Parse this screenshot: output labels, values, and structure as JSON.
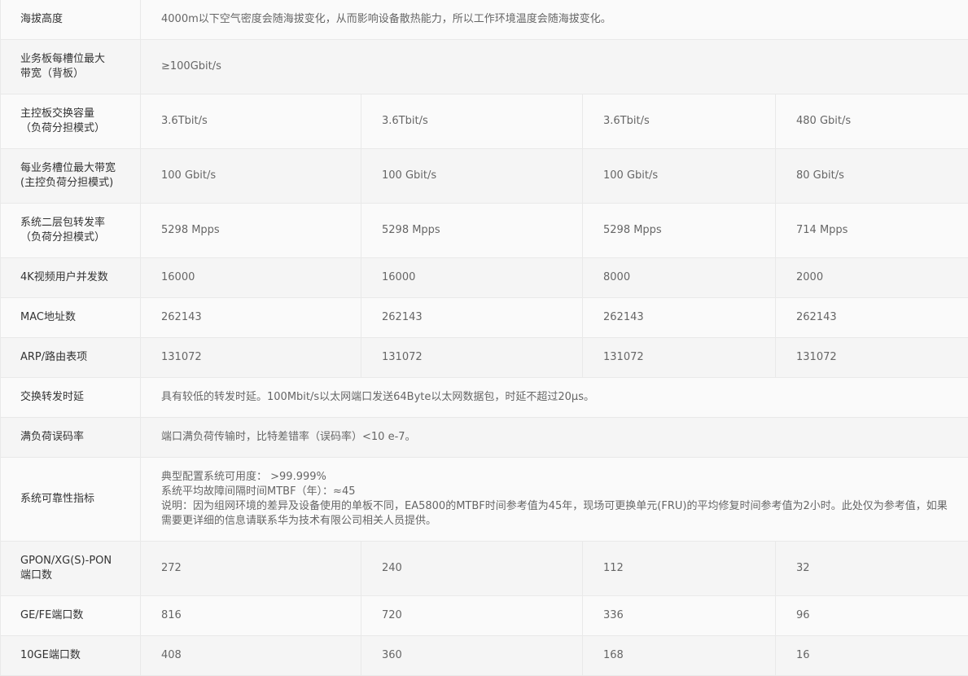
{
  "rows": [
    {
      "label": "海拔高度",
      "span": "4000m以下空气密度会随海拔变化，从而影响设备散热能力，所以工作环境温度会随海拔变化。"
    },
    {
      "label": "业务板每槽位最大带宽（背板）",
      "span": "≥100Gbit/s"
    },
    {
      "label": "主控板交换容量\n（负荷分担模式）",
      "cells": [
        "3.6Tbit/s",
        "3.6Tbit/s",
        "3.6Tbit/s",
        "480 Gbit/s"
      ]
    },
    {
      "label": "每业务槽位最大带宽\n(主控负荷分担模式)",
      "cells": [
        "100 Gbit/s",
        "100 Gbit/s",
        "100 Gbit/s",
        "80 Gbit/s"
      ]
    },
    {
      "label": "系统二层包转发率\n（负荷分担模式）",
      "cells": [
        "5298 Mpps",
        "5298 Mpps",
        "5298 Mpps",
        "714 Mpps"
      ]
    },
    {
      "label": "4K视频用户并发数",
      "cells": [
        "16000",
        "16000",
        "8000",
        "2000"
      ]
    },
    {
      "label": "MAC地址数",
      "cells": [
        "262143",
        "262143",
        "262143",
        "262143"
      ]
    },
    {
      "label": "ARP/路由表项",
      "cells": [
        "131072",
        "131072",
        "131072",
        "131072"
      ]
    },
    {
      "label": "交换转发时延",
      "span": "具有较低的转发时延。100Mbit/s以太网端口发送64Byte以太网数据包，时延不超过20μs。"
    },
    {
      "label": "满负荷误码率",
      "span": "端口满负荷传输时，比特差错率（误码率）<10 e-7。"
    },
    {
      "label": "系统可靠性指标",
      "lines": [
        "典型配置系统可用度： >99.999%",
        "系统平均故障间隔时间MTBF（年）：≈45",
        "说明：因为组网环境的差异及设备使用的单板不同，EA5800的MTBF时间参考值为45年，现场可更换单元(FRU)的平均修复时间参考值为2小时。此处仅为参考值，如果需要更详细的信息请联系华为技术有限公司相关人员提供。"
      ]
    },
    {
      "label": "GPON/XG(S)-PON端口数",
      "cells": [
        "272",
        "240",
        "112",
        "32"
      ]
    },
    {
      "label": "GE/FE端口数",
      "cells": [
        "816",
        "720",
        "336",
        "96"
      ]
    },
    {
      "label": "10GE端口数",
      "cells": [
        "408",
        "360",
        "168",
        "16"
      ]
    }
  ]
}
